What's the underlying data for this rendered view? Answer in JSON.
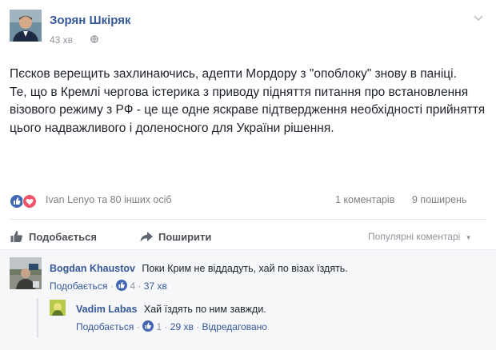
{
  "post": {
    "author": "Зорян Шкіряк",
    "time": "43 хв",
    "paragraphs": [
      "Пєсков верещить захлинаючись, адепти Мордору з \"опоблоку\" знову в паніці.",
      "Те, що в Кремлі чергова істерика з приводу підняття питання про встановлення візового режиму з РФ - це ще одне яскраве підтвердження необхідності прийняття цього надважливого і доленосного для України рішення."
    ]
  },
  "stats": {
    "reactions_text": "Ivan Lenyo та 80 інших осіб",
    "comments": "1 коментарів",
    "shares": "9 поширень"
  },
  "actions": {
    "like": "Подобається",
    "share": "Поширити",
    "sort": "Популярні коментарі"
  },
  "comments": [
    {
      "author": "Bogdan Khaustov",
      "text": "Поки Крим не віддадуть, хай по візах їздять.",
      "like_label": "Подобається",
      "likes": "4",
      "time": "37 хв"
    },
    {
      "author": "Vadim Labas",
      "text": "Хай їздять по ним завжди.",
      "like_label": "Подобається",
      "likes": "1",
      "time": "29 хв",
      "edited": "Відредаговано"
    }
  ],
  "colors": {
    "link": "#365899",
    "muted": "#90949c",
    "like": "#4267b2",
    "love": "#f25268"
  }
}
